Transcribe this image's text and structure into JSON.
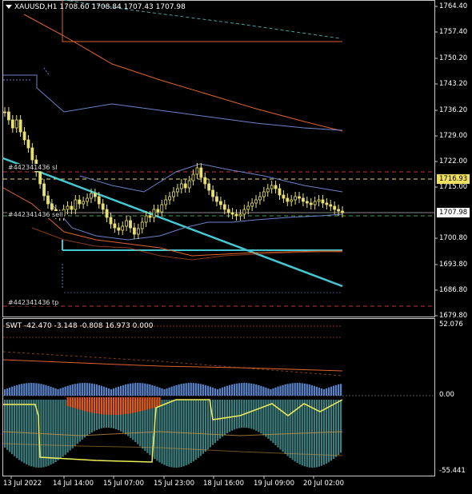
{
  "window": {
    "symbol_label": "XAUUSD,H1",
    "ohlc": {
      "open": "1708.60",
      "high": "1708.84",
      "low": "1707.43",
      "close": "1707.98"
    }
  },
  "orders": {
    "sl_label": "#442341436 sl",
    "entry_label": "#442341436 sell",
    "tp_label": "#442341436 tp"
  },
  "price_axis": {
    "ticks": [
      "1764.40",
      "1757.40",
      "1750.20",
      "1743.20",
      "1736.20",
      "1729.00",
      "1722.00",
      "1715.00",
      "1700.80",
      "1693.80",
      "1686.80",
      "1679.80"
    ],
    "current_price": "1707.98",
    "marked_price": "1716.93"
  },
  "indicator": {
    "header": "SWT -42.470 -3.148 -0.808 16.973 0.000",
    "ticks": [
      "52.076",
      "0.00",
      "-55.441"
    ]
  },
  "time_axis": {
    "ticks": [
      "13 Jul 2022",
      "14 Jul 14:00",
      "15 Jul 07:00",
      "15 Jul 23:00",
      "18 Jul 16:00",
      "19 Jul 09:00",
      "20 Jul 02:00"
    ]
  },
  "colors": {
    "background": "#000000",
    "grid_border": "#c8c8c8",
    "candle": "#e8e070",
    "sl_line": "#c83232",
    "tp_line": "#c83232",
    "entry_line": "#3fa34d",
    "trendline": "#46c8d2",
    "horizontal_level": "#46c8d2",
    "ma_orange": "#e0642c",
    "envelope_blue": "#6c82c8",
    "current_price_tag": "#ffffff",
    "marked_price_tag": "#f0e060",
    "hist_blue": "#5a82c8",
    "hist_orange": "#e05a1e",
    "hist_teal": "#5ab4b4",
    "ind_yellow": "#f0f05a"
  }
}
